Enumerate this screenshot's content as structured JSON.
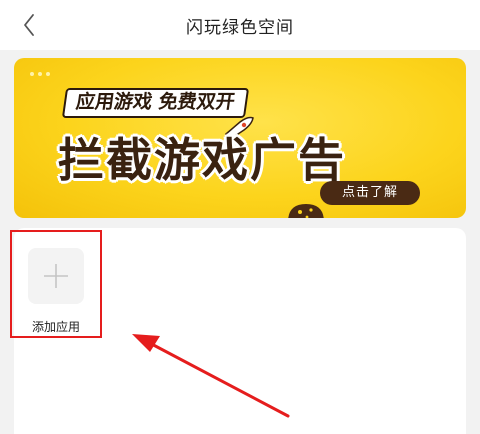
{
  "nav": {
    "title": "闪玩绿色空间",
    "back_icon": "chevron-left-icon"
  },
  "banner": {
    "subtitle": "应用游戏 免费双开",
    "headline": "拦截游戏广告",
    "cta": "点击了解",
    "colors": {
      "background": "#fcd41c",
      "headline": "#3a2210",
      "cta_bg": "#4a2a14"
    }
  },
  "apps": {
    "add_label": "添加应用",
    "add_icon": "plus-icon"
  },
  "annotation": {
    "highlight_color": "#e51d1d",
    "arrow_icon": "red-arrow"
  }
}
